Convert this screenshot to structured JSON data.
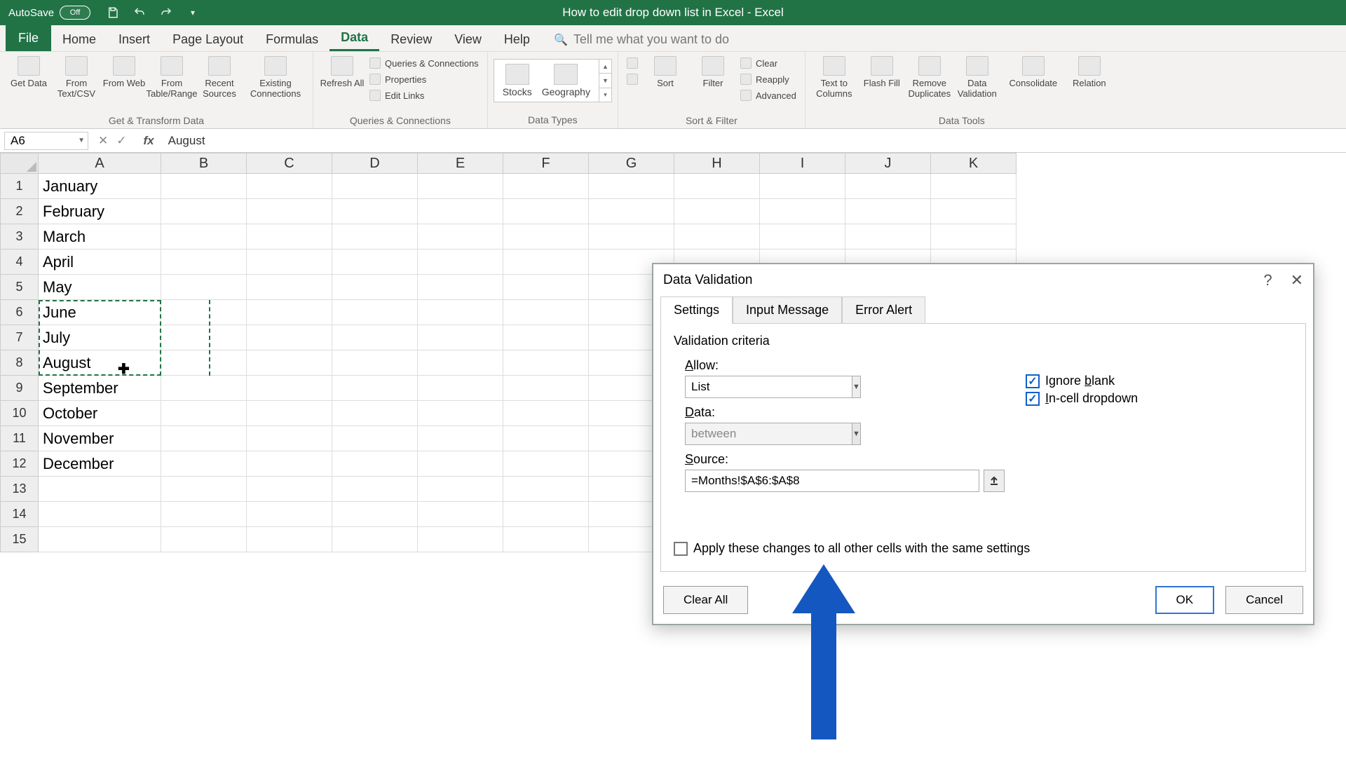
{
  "titlebar": {
    "autosave_label": "AutoSave",
    "autosave_state": "Off",
    "doc_title": "How to edit drop down list in Excel  -  Excel"
  },
  "tabs": {
    "file": "File",
    "home": "Home",
    "insert": "Insert",
    "page_layout": "Page Layout",
    "formulas": "Formulas",
    "data": "Data",
    "review": "Review",
    "view": "View",
    "help": "Help",
    "tellme": "Tell me what you want to do"
  },
  "ribbon": {
    "get_transform": {
      "label": "Get & Transform Data",
      "get_data": "Get Data",
      "from_textcsv": "From Text/CSV",
      "from_web": "From Web",
      "from_table": "From Table/Range",
      "recent": "Recent Sources",
      "existing": "Existing Connections"
    },
    "queries": {
      "label": "Queries & Connections",
      "refresh": "Refresh All",
      "qc": "Queries & Connections",
      "props": "Properties",
      "edit_links": "Edit Links"
    },
    "data_types": {
      "label": "Data Types",
      "stocks": "Stocks",
      "geography": "Geography"
    },
    "sort_filter": {
      "label": "Sort & Filter",
      "sort": "Sort",
      "filter": "Filter",
      "clear": "Clear",
      "reapply": "Reapply",
      "advanced": "Advanced"
    },
    "data_tools": {
      "label": "Data Tools",
      "text_to_cols": "Text to Columns",
      "flash_fill": "Flash Fill",
      "remove_dup": "Remove Duplicates",
      "validation": "Data Validation",
      "consolidate": "Consolidate",
      "relations": "Relation"
    }
  },
  "formula_bar": {
    "name_box": "A6",
    "value": "August"
  },
  "columns": [
    "A",
    "B",
    "C",
    "D",
    "E",
    "F",
    "G",
    "H",
    "I",
    "J",
    "K"
  ],
  "rows": [
    {
      "n": "1",
      "a": "January"
    },
    {
      "n": "2",
      "a": "February"
    },
    {
      "n": "3",
      "a": "March"
    },
    {
      "n": "4",
      "a": "April"
    },
    {
      "n": "5",
      "a": "May"
    },
    {
      "n": "6",
      "a": "June"
    },
    {
      "n": "7",
      "a": "July"
    },
    {
      "n": "8",
      "a": "August"
    },
    {
      "n": "9",
      "a": "September"
    },
    {
      "n": "10",
      "a": "October"
    },
    {
      "n": "11",
      "a": "November"
    },
    {
      "n": "12",
      "a": "December"
    },
    {
      "n": "13",
      "a": ""
    },
    {
      "n": "14",
      "a": ""
    },
    {
      "n": "15",
      "a": ""
    }
  ],
  "dialog": {
    "title": "Data Validation",
    "tab_settings": "Settings",
    "tab_input": "Input Message",
    "tab_error": "Error Alert",
    "criteria_label": "Validation criteria",
    "allow_label": "Allow:",
    "allow_value": "List",
    "data_label": "Data:",
    "data_value": "between",
    "ignore_blank": "Ignore blank",
    "incell_dropdown": "In-cell dropdown",
    "source_label": "Source:",
    "source_value": "=Months!$A$6:$A$8",
    "apply_label": "Apply these changes to all other cells with the same settings",
    "clear_all": "Clear All",
    "ok": "OK",
    "cancel": "Cancel"
  }
}
